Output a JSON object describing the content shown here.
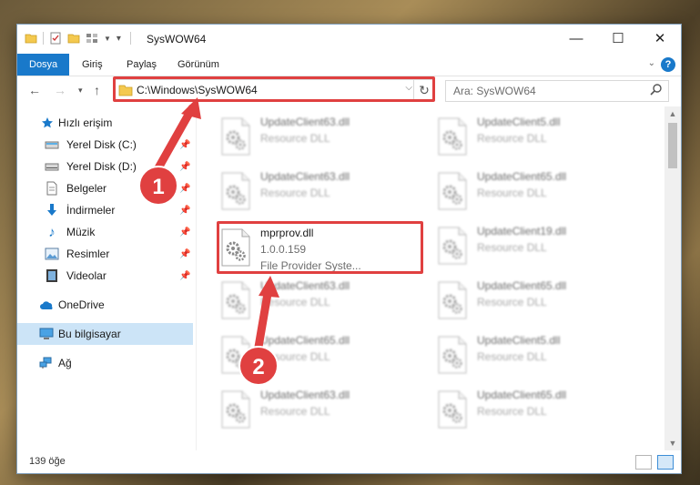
{
  "window": {
    "title": "SysWOW64",
    "controls": {
      "minimize": "—",
      "maximize": "☐",
      "close": "✕"
    }
  },
  "ribbon": {
    "tabs": [
      {
        "label": "Dosya",
        "active": true
      },
      {
        "label": "Giriş"
      },
      {
        "label": "Paylaş"
      },
      {
        "label": "Görünüm"
      }
    ],
    "help": "?"
  },
  "address": {
    "path": "C:\\Windows\\SysWOW64",
    "search_placeholder": "Ara: SysWOW64"
  },
  "sidebar": {
    "items": [
      {
        "label": "Hızlı erişim",
        "icon": "star-icon",
        "color": "#1979ca"
      },
      {
        "label": "Yerel Disk (C:)",
        "icon": "drive-icon",
        "pinned": true
      },
      {
        "label": "Yerel Disk (D:)",
        "icon": "drive-icon",
        "pinned": true
      },
      {
        "label": "Belgeler",
        "icon": "document-icon",
        "pinned": true
      },
      {
        "label": "İndirmeler",
        "icon": "download-icon",
        "pinned": true
      },
      {
        "label": "Müzik",
        "icon": "music-icon",
        "pinned": true
      },
      {
        "label": "Resimler",
        "icon": "picture-icon",
        "pinned": true
      },
      {
        "label": "Videolar",
        "icon": "video-icon",
        "pinned": true
      },
      {
        "label": "OneDrive",
        "icon": "cloud-icon"
      },
      {
        "label": "Bu bilgisayar",
        "icon": "computer-icon",
        "selected": true
      },
      {
        "label": "Ağ",
        "icon": "network-icon"
      }
    ]
  },
  "files": [
    {
      "name": "UpdateClient63.dll",
      "type": "Resource DLL",
      "blurred": true
    },
    {
      "name": "UpdateClient5.dll",
      "type": "Resource DLL",
      "blurred": true
    },
    {
      "name": "UpdateClient63.dll",
      "type": "Resource DLL",
      "blurred": true
    },
    {
      "name": "UpdateClient65.dll",
      "type": "Resource DLL",
      "blurred": true
    },
    {
      "name": "mprprov.dll",
      "version": "1.0.0.159",
      "type": "File Provider Syste...",
      "blurred": false,
      "highlighted": true
    },
    {
      "name": "UpdateClient19.dll",
      "type": "Resource DLL",
      "blurred": true
    },
    {
      "name": "UpdateClient63.dll",
      "type": "Resource DLL",
      "blurred": true
    },
    {
      "name": "UpdateClient65.dll",
      "type": "Resource DLL",
      "blurred": true
    },
    {
      "name": "UpdateClient65.dll",
      "type": "Resource DLL",
      "blurred": true
    },
    {
      "name": "UpdateClient5.dll",
      "type": "Resource DLL",
      "blurred": true
    },
    {
      "name": "UpdateClient63.dll",
      "type": "Resource DLL",
      "blurred": true
    },
    {
      "name": "UpdateClient65.dll",
      "type": "Resource DLL",
      "blurred": true
    }
  ],
  "annotations": [
    {
      "number": "1",
      "color": "#e04040"
    },
    {
      "number": "2",
      "color": "#e04040"
    }
  ],
  "status": {
    "count": "139 öğe"
  }
}
